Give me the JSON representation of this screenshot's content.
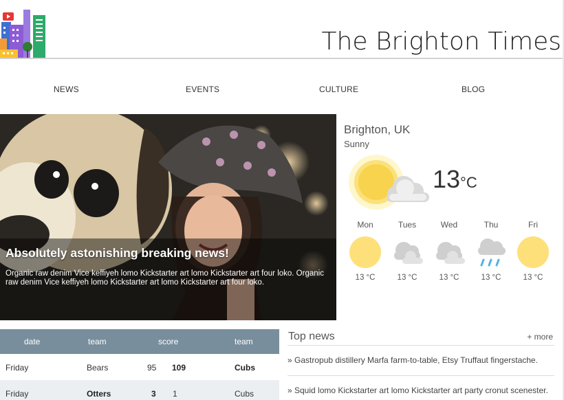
{
  "site": {
    "title": "The Brighton Times",
    "logo": "city-skyline-logo"
  },
  "nav": {
    "items": [
      "NEWS",
      "EVENTS",
      "CULTURE",
      "BLOG"
    ]
  },
  "hero": {
    "title": "Absolutely astonishing breaking news!",
    "text": "Organic raw denim Vice keffiyeh lomo Kickstarter art lomo Kickstarter art four loko. Organic raw denim Vice keffiyeh lomo Kickstarter art lomo Kickstarter art four loko."
  },
  "weather": {
    "city": "Brighton, UK",
    "condition": "Sunny",
    "temp": "13",
    "unit": "°C",
    "forecast": [
      {
        "day": "Mon",
        "icon": "sun-icon",
        "temp": "13 °C"
      },
      {
        "day": "Tues",
        "icon": "cloud-icon",
        "temp": "13 °C"
      },
      {
        "day": "Wed",
        "icon": "cloud-icon",
        "temp": "13 °C"
      },
      {
        "day": "Thu",
        "icon": "rain-icon",
        "temp": "13 °C"
      },
      {
        "day": "Fri",
        "icon": "sun-icon",
        "temp": "13 °C"
      }
    ],
    "colors": {
      "sun": "#fcd96b",
      "cloud": "#c9c9c9",
      "rain": "#4fb3e8"
    }
  },
  "scores": {
    "headers": [
      "date",
      "team",
      "score",
      "team"
    ],
    "rows": [
      {
        "date": "Friday",
        "home": "Bears",
        "home_score": "95",
        "away_score": "109",
        "away": "Cubs",
        "winner": "away"
      },
      {
        "date": "Friday",
        "home": "Otters",
        "home_score": "3",
        "away_score": "1",
        "away": "Cubs",
        "winner": "home"
      }
    ],
    "header_color": "#788e9c"
  },
  "top_news": {
    "title": "Top news",
    "more": "+ more",
    "items": [
      "» Gastropub distillery Marfa farm-to-table, Etsy Truffaut fingerstache.",
      "» Squid lomo Kickstarter art lomo Kickstarter art party cronut scenester."
    ]
  }
}
